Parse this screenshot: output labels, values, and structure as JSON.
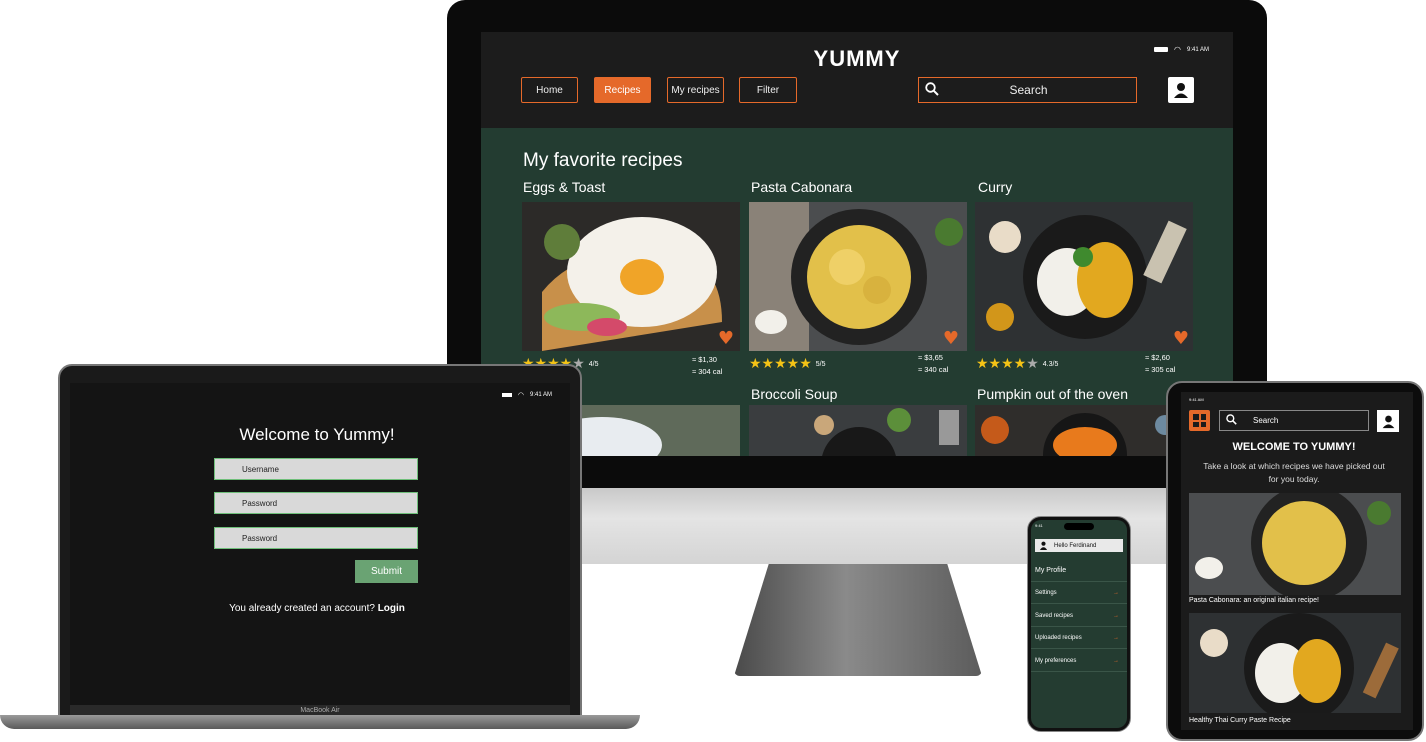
{
  "desktop": {
    "brand": "YUMMY",
    "status_time": "9:41 AM",
    "nav": [
      "Home",
      "Recipes",
      "My recipes",
      "Filter"
    ],
    "active_nav": "Recipes",
    "search_label": "Search",
    "section_title": "My favorite recipes",
    "recipes": [
      {
        "name": "Eggs & Toast",
        "rating": "4/5",
        "price": "≈ $1,30",
        "calories": "≈ 304 cal"
      },
      {
        "name": "Pasta Cabonara",
        "rating": "5/5",
        "price": "≈ $3,65",
        "calories": "≈ 340 cal"
      },
      {
        "name": "Curry",
        "rating": "4.3/5",
        "price": "≈ $2,60",
        "calories": "≈ 305 cal"
      }
    ],
    "recipes_row2": [
      "Broccoli Soup",
      "Pumpkin out of the oven"
    ],
    "accent_color": "#e5692a",
    "bg_color": "#233c31"
  },
  "laptop": {
    "status_time": "9:41 AM",
    "welcome": "Welcome to Yummy!",
    "fields": [
      "Username",
      "Password",
      "Password"
    ],
    "submit": "Submit",
    "account_prompt": "You already created an account?",
    "login_link": "Login",
    "model_label": "MacBook Air"
  },
  "phone": {
    "status_time": "9:41",
    "greeting": "Hello Ferdinand",
    "profile_heading": "My Profile",
    "menu": [
      "Settings",
      "Saved recipes",
      "Uploaded recipes",
      "My preferences"
    ]
  },
  "tablet": {
    "status_time": "9:41 AM",
    "search_label": "Search",
    "title": "WELCOME TO YUMMY!",
    "subtitle": "Take a look at which recipes we have picked out for you today.",
    "captions": [
      "Pasta Cabonara: an original italian recipe!",
      "Healthy Thai Curry Paste Recipe"
    ]
  }
}
